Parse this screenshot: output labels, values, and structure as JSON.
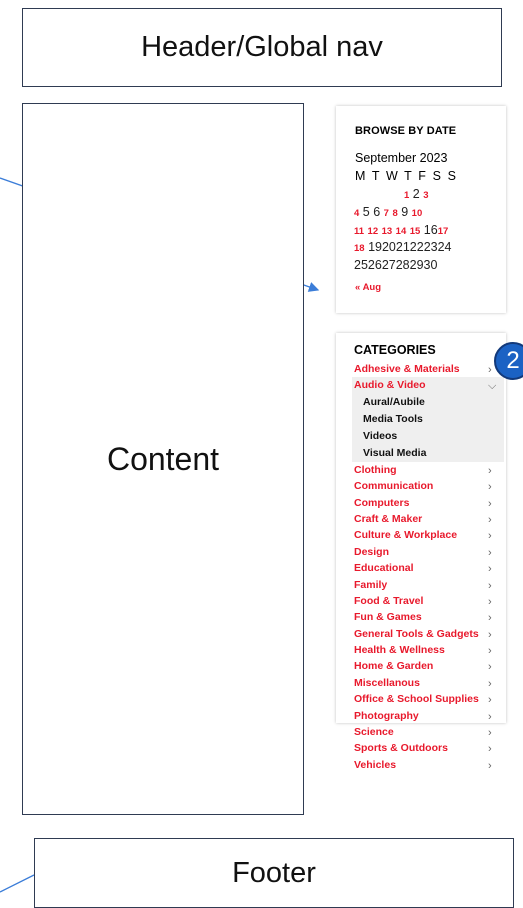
{
  "labels": {
    "header": "Header/Global nav",
    "content": "Content",
    "footer": "Footer",
    "badge": "2"
  },
  "calendar": {
    "title": "BROWSE BY DATE",
    "month": "September 2023",
    "weekdays": "M T W T F S S",
    "row1": [
      "1",
      "2",
      "3"
    ],
    "row2": [
      "4",
      "5",
      "6",
      "7",
      "8",
      "9",
      "10"
    ],
    "row3": [
      "11",
      "12",
      "13",
      "14",
      "15",
      "16",
      "17"
    ],
    "row4": [
      "18",
      "19",
      "20",
      "21",
      "22",
      "23",
      "24"
    ],
    "row5": [
      "25",
      "26",
      "27",
      "28",
      "29",
      "30"
    ],
    "prev_link": "« Aug"
  },
  "categories": {
    "title": "CATEGORIES",
    "items": [
      {
        "label": "Adhesive & Materials"
      },
      {
        "label": "Audio & Video",
        "expanded": true,
        "children": [
          "Aural/Aubile",
          "Media Tools",
          "Videos",
          "Visual Media"
        ]
      },
      {
        "label": "Clothing"
      },
      {
        "label": "Communication"
      },
      {
        "label": "Computers"
      },
      {
        "label": "Craft & Maker"
      },
      {
        "label": "Culture & Workplace"
      },
      {
        "label": "Design"
      },
      {
        "label": "Educational"
      },
      {
        "label": "Family"
      },
      {
        "label": "Food & Travel"
      },
      {
        "label": "Fun & Games"
      },
      {
        "label": "General Tools & Gadgets"
      },
      {
        "label": "Health & Wellness"
      },
      {
        "label": "Home & Garden"
      },
      {
        "label": "Miscellanous"
      },
      {
        "label": "Office & School Supplies"
      },
      {
        "label": "Photography"
      },
      {
        "label": "Science"
      },
      {
        "label": "Sports & Outdoors"
      },
      {
        "label": "Vehicles"
      }
    ]
  },
  "colors": {
    "link_red": "#e8192c",
    "arrow_blue": "#3b7dd8",
    "badge_blue": "#1b62c4"
  }
}
